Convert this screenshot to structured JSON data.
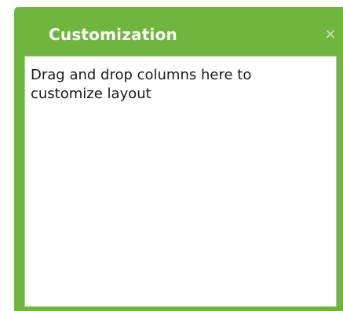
{
  "panel": {
    "title": "Customization",
    "close_label": "×",
    "hint": "Drag and drop columns here to customize layout"
  },
  "colors": {
    "header_bg": "#6fb63f",
    "title_text": "#ffffff",
    "close_glyph": "#cfe8bd",
    "content_bg": "#ffffff"
  }
}
